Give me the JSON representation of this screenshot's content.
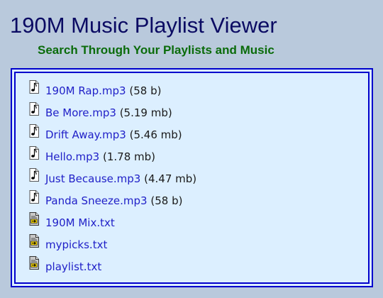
{
  "header": {
    "title": "190M Music Playlist Viewer",
    "subtitle": "Search Through Your Playlists and Music"
  },
  "colors": {
    "background": "#b9c9dc",
    "title": "#0b0b63",
    "subtitle": "#0a6b0a",
    "box_border": "#0000cc",
    "box_fill": "#dcefff",
    "link": "#2121c8"
  },
  "files": [
    {
      "name": "190M Rap.mp3",
      "size": "(58 b)",
      "icon": "music-note-icon"
    },
    {
      "name": "Be More.mp3",
      "size": "(5.19 mb)",
      "icon": "music-note-icon"
    },
    {
      "name": "Drift Away.mp3",
      "size": "(5.46 mb)",
      "icon": "music-note-icon"
    },
    {
      "name": "Hello.mp3",
      "size": "(1.78 mb)",
      "icon": "music-note-icon"
    },
    {
      "name": "Just Because.mp3",
      "size": "(4.47 mb)",
      "icon": "music-note-icon"
    },
    {
      "name": "Panda Sneeze.mp3",
      "size": "(58 b)",
      "icon": "music-note-icon"
    },
    {
      "name": "190M Mix.txt",
      "size": "",
      "icon": "playlist-file-icon"
    },
    {
      "name": "mypicks.txt",
      "size": "",
      "icon": "playlist-file-icon"
    },
    {
      "name": "playlist.txt",
      "size": "",
      "icon": "playlist-file-icon"
    }
  ]
}
